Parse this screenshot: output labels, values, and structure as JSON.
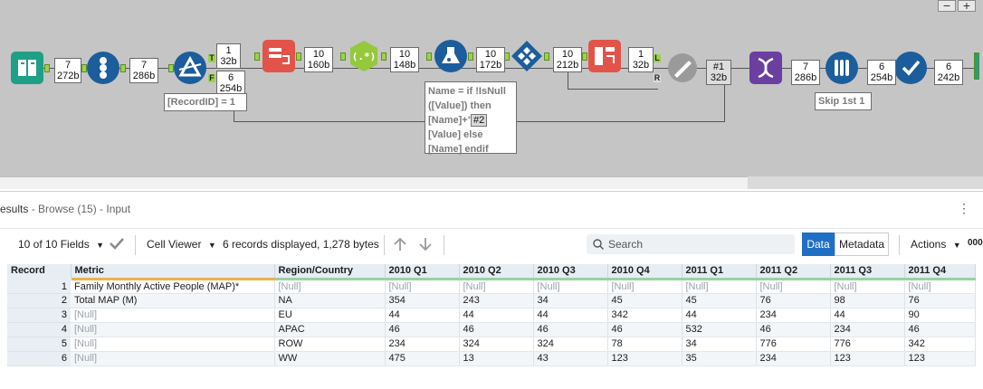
{
  "canvas": {
    "zoom_out": "−",
    "zoom_in": "+",
    "records": [
      {
        "id": "r1",
        "count": "7",
        "size": "272b"
      },
      {
        "id": "r2",
        "count": "7",
        "size": "286b"
      },
      {
        "id": "r3",
        "count": "1",
        "size": "32b"
      },
      {
        "id": "r4",
        "count": "6",
        "size": "254b"
      },
      {
        "id": "r5",
        "count": "10",
        "size": "160b"
      },
      {
        "id": "r6",
        "count": "10",
        "size": "148b"
      },
      {
        "id": "r7",
        "count": "10",
        "size": "172b"
      },
      {
        "id": "r8",
        "count": "10",
        "size": "212b"
      },
      {
        "id": "r9",
        "count": "1",
        "size": "32b"
      },
      {
        "id": "r10",
        "count": "#1",
        "size": "32b"
      },
      {
        "id": "r11",
        "count": "7",
        "size": "286b"
      },
      {
        "id": "r12",
        "count": "6",
        "size": "254b"
      },
      {
        "id": "r13",
        "count": "6",
        "size": "242b"
      }
    ],
    "filter_note": "[RecordID] = 1",
    "formula_note": [
      "Name = if !IsNull",
      "([Value]) then",
      "[Name]+\"-\"+",
      "[Value] else",
      "[Name] endif"
    ],
    "formula_tag": "#2",
    "skip_note": "Skip 1st 1",
    "anchor_t": "T",
    "anchor_f": "F",
    "anchor_l": "L",
    "anchor_r": "R"
  },
  "results": {
    "title": "esults",
    "subtitle": " - Browse (15) - Input",
    "kebab": "⋮",
    "fields": "10 of 10 Fields",
    "viewer": "Cell Viewer",
    "summary": "6 records displayed, 1,278 bytes",
    "search_placeholder": "Search",
    "tab_data": "Data",
    "tab_metadata": "Metadata",
    "actions": "Actions",
    "more": "000"
  },
  "table": {
    "headers": [
      "Record",
      "Metric",
      "Region/Country",
      "2010 Q1",
      "2010 Q2",
      "2010 Q3",
      "2010 Q4",
      "2011 Q1",
      "2011 Q2",
      "2011 Q3",
      "2011 Q4"
    ],
    "rows": [
      [
        "1",
        "Family Monthly Active People (MAP)*",
        "[Null]",
        "[Null]",
        "[Null]",
        "[Null]",
        "[Null]",
        "[Null]",
        "[Null]",
        "[Null]",
        "[Null]"
      ],
      [
        "2",
        "Total MAP (M)",
        "NA",
        "354",
        "243",
        "34",
        "45",
        "45",
        "76",
        "98",
        "76"
      ],
      [
        "3",
        "[Null]",
        "EU",
        "44",
        "44",
        "44",
        "342",
        "44",
        "234",
        "44",
        "90"
      ],
      [
        "4",
        "[Null]",
        "APAC",
        "46",
        "46",
        "46",
        "46",
        "532",
        "46",
        "234",
        "46"
      ],
      [
        "5",
        "[Null]",
        "ROW",
        "234",
        "324",
        "324",
        "78",
        "34",
        "776",
        "776",
        "342"
      ],
      [
        "6",
        "[Null]",
        "WW",
        "475",
        "13",
        "43",
        "123",
        "35",
        "234",
        "123",
        "123"
      ]
    ]
  },
  "colors": {
    "canvas_bg": "#c5c5c5",
    "data_tab": "#1f6fc5",
    "null_text": "#9aa3ad"
  }
}
